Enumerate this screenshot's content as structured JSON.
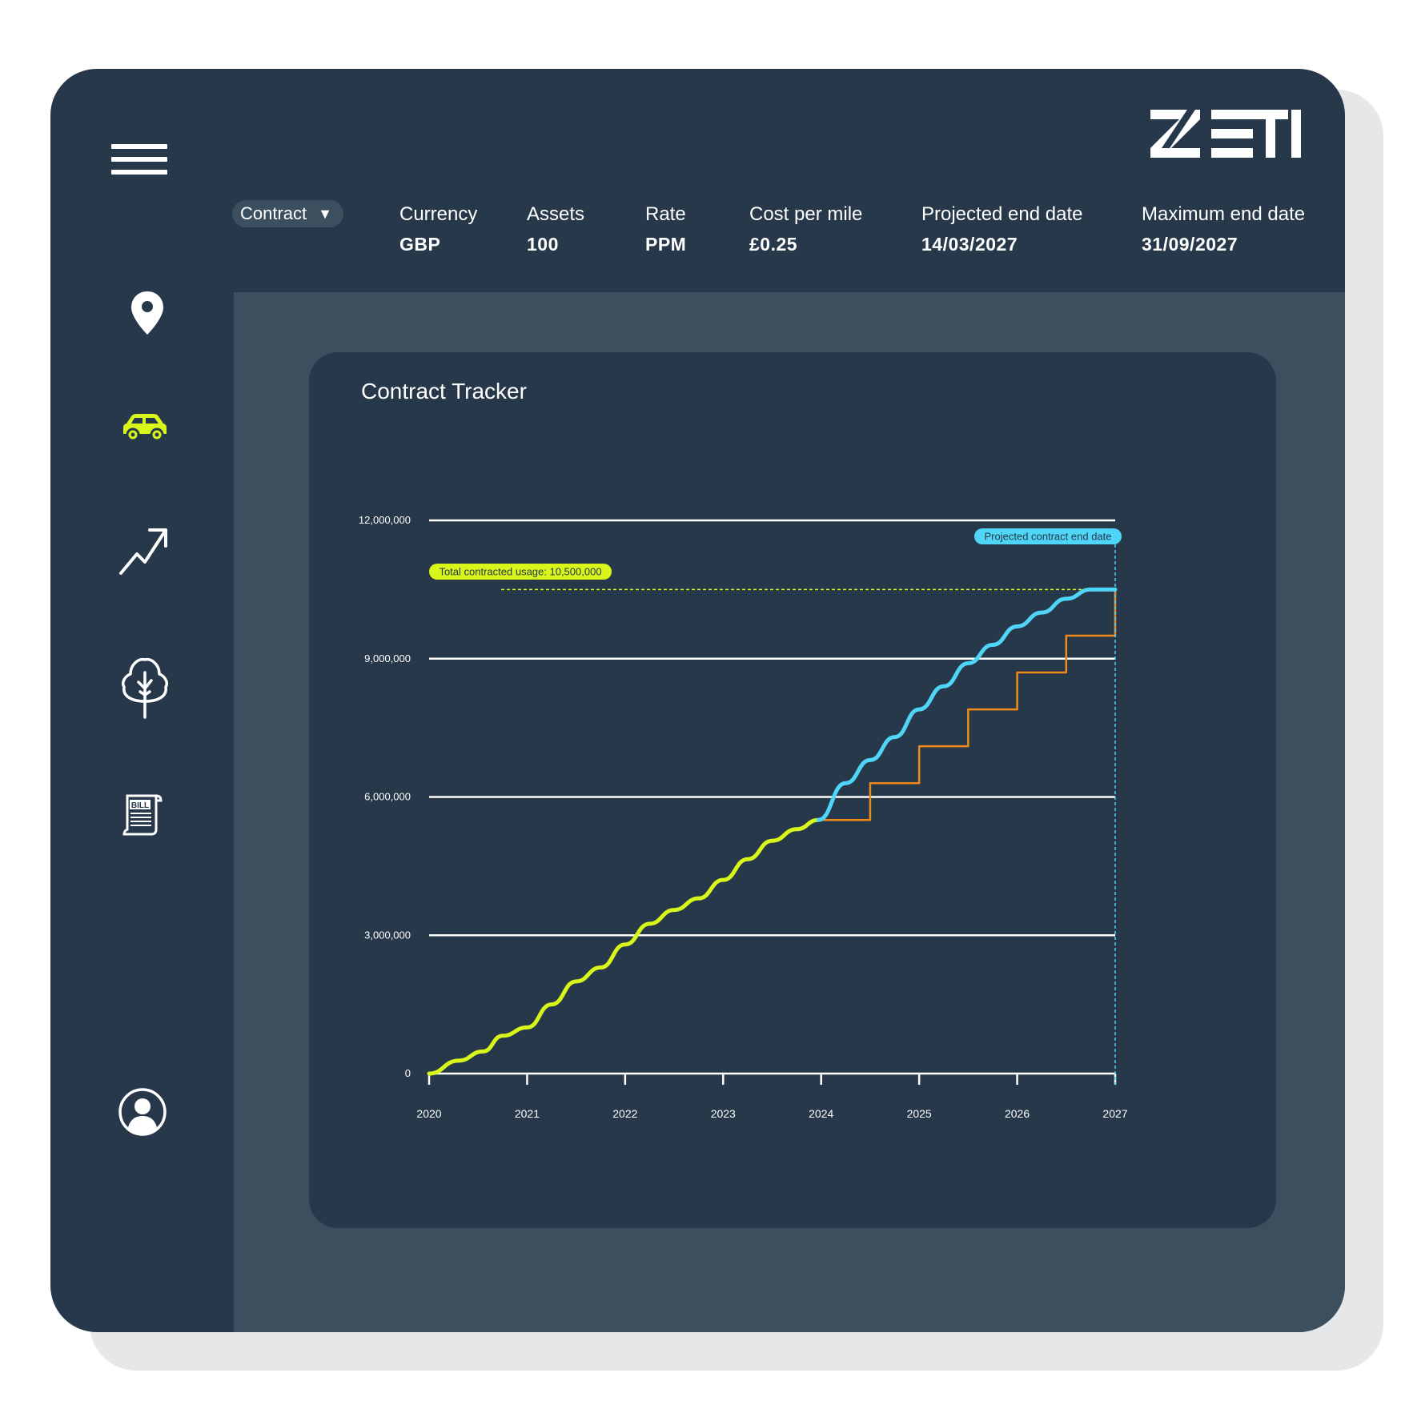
{
  "brand": {
    "logo_text": "ZETI",
    "accent": "#d9f61b",
    "projected": "#4fd5f7",
    "step": "#f08a1b"
  },
  "nav": [
    {
      "name": "location-pin-icon",
      "active": false
    },
    {
      "name": "car-icon",
      "active": true
    },
    {
      "name": "trend-up-icon",
      "active": false
    },
    {
      "name": "tree-icon",
      "active": false
    },
    {
      "name": "bill-icon",
      "active": false,
      "text": "BILL"
    },
    {
      "name": "user-icon",
      "active": false
    }
  ],
  "header": {
    "dropdown": {
      "label": "Contract",
      "caret": "▼"
    },
    "stats": [
      {
        "label": "Currency",
        "value": "GBP"
      },
      {
        "label": "Assets",
        "value": "100"
      },
      {
        "label": "Rate",
        "value": "PPM"
      },
      {
        "label": "Cost per mile",
        "value": "£0.25"
      },
      {
        "label": "Projected end date",
        "value": "14/03/2027"
      },
      {
        "label": "Maximum end date",
        "value": "31/09/2027"
      }
    ]
  },
  "card": {
    "title": "Contract Tracker"
  },
  "chart_data": {
    "type": "line",
    "title": "Contract Tracker",
    "xlabel": "",
    "ylabel": "",
    "x_ticks": [
      "2020",
      "2021",
      "2022",
      "2023",
      "2024",
      "2025",
      "2026",
      "2027"
    ],
    "y_ticks": [
      {
        "value": 0,
        "label": "0"
      },
      {
        "value": 3000000,
        "label": "3,000,000"
      },
      {
        "value": 6000000,
        "label": "6,000,000"
      },
      {
        "value": 9000000,
        "label": "9,000,000"
      },
      {
        "value": 12000000,
        "label": "12,000,000"
      }
    ],
    "xlim": [
      2020,
      2027
    ],
    "ylim": [
      0,
      12000000
    ],
    "grid": true,
    "annotations": [
      {
        "text": "Total contracted usage: 10,500,000",
        "y": 10500000
      },
      {
        "text": "Projected contract end date",
        "x": 2027
      }
    ],
    "series": [
      {
        "style": "actual",
        "color": "#d9f61b",
        "x": [
          2020.0,
          2020.3,
          2020.55,
          2020.75,
          2021.0,
          2021.25,
          2021.5,
          2021.75,
          2022.0,
          2022.25,
          2022.5,
          2022.75,
          2023.0,
          2023.25,
          2023.5,
          2023.75,
          2023.97
        ],
        "y": [
          0,
          280000,
          480000,
          820000,
          1000000,
          1500000,
          2000000,
          2300000,
          2800000,
          3250000,
          3550000,
          3800000,
          4200000,
          4650000,
          5050000,
          5300000,
          5500000
        ]
      },
      {
        "style": "projected",
        "color": "#4fd5f7",
        "x": [
          2023.97,
          2024.25,
          2024.5,
          2024.75,
          2025.0,
          2025.25,
          2025.5,
          2025.75,
          2026.0,
          2026.25,
          2026.5,
          2026.75,
          2027.0
        ],
        "y": [
          5500000,
          6300000,
          6800000,
          7300000,
          7900000,
          8400000,
          8900000,
          9300000,
          9700000,
          10000000,
          10300000,
          10500000,
          10500000
        ]
      },
      {
        "style": "step",
        "color": "#f08a1b",
        "x": [
          2024.0,
          2024.5,
          2024.5,
          2025.0,
          2025.0,
          2025.5,
          2025.5,
          2026.0,
          2026.0,
          2026.5,
          2026.5,
          2027.0,
          2027.0
        ],
        "y": [
          5500000,
          5500000,
          6300000,
          6300000,
          7100000,
          7100000,
          7900000,
          7900000,
          8700000,
          8700000,
          9500000,
          9500000,
          10500000
        ]
      }
    ]
  }
}
